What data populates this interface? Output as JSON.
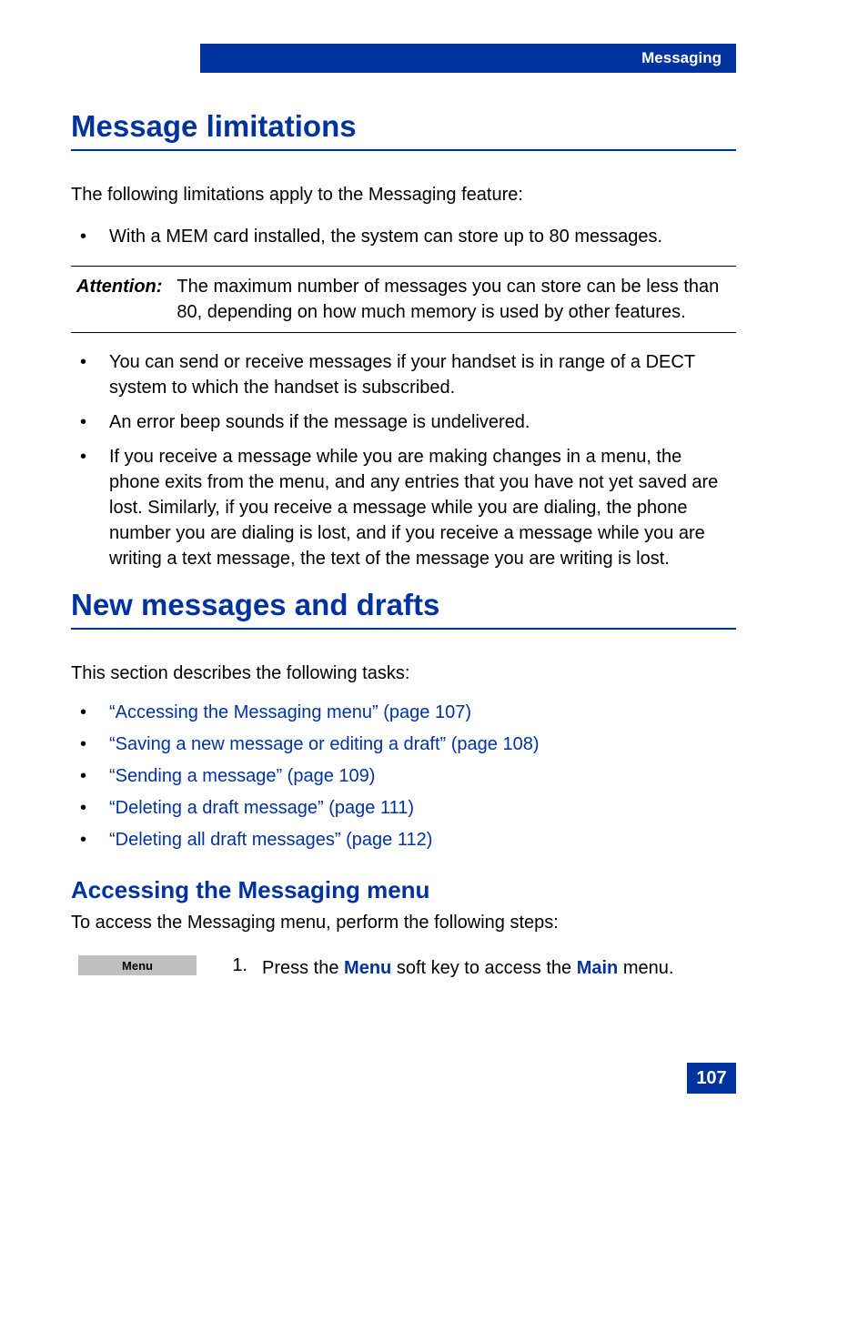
{
  "header": {
    "title": "Messaging"
  },
  "section1": {
    "heading": "Message limitations",
    "intro": "The following limitations apply to the Messaging feature:",
    "bullet1": "With a MEM card installed, the system can store up to 80 messages.",
    "attention_label": "Attention:",
    "attention_text": "The maximum number of messages you can store can be less than 80, depending on how much memory is used by other features.",
    "bullet2": "You can send or receive messages if your handset is in range of a DECT system to which the handset is subscribed.",
    "bullet3": "An error beep sounds if the message is undelivered.",
    "bullet4": "If you receive a message while you are making changes in a menu, the phone exits from the menu, and any entries that you have not yet saved are lost. Similarly, if you receive a message while you are dialing, the phone number you are dialing is lost, and if you receive a message while you are writing a text message, the text of the message you are writing is lost."
  },
  "section2": {
    "heading": "New messages and drafts",
    "intro": "This section describes the following tasks:",
    "links": [
      "“Accessing the Messaging menu” (page 107)",
      "“Saving a new message or editing a draft” (page 108)",
      "“Sending a message” (page 109)",
      "“Deleting a draft message” (page 111)",
      "“Deleting all draft messages” (page 112)"
    ]
  },
  "section3": {
    "heading": "Accessing the Messaging menu",
    "intro": "To access the Messaging menu, perform the following steps:",
    "softkey": "Menu",
    "step_num": "1.",
    "step_prefix": "Press the ",
    "step_key1": "Menu",
    "step_mid": " soft key to access the ",
    "step_key2": "Main",
    "step_suffix": " menu."
  },
  "page_number": "107"
}
